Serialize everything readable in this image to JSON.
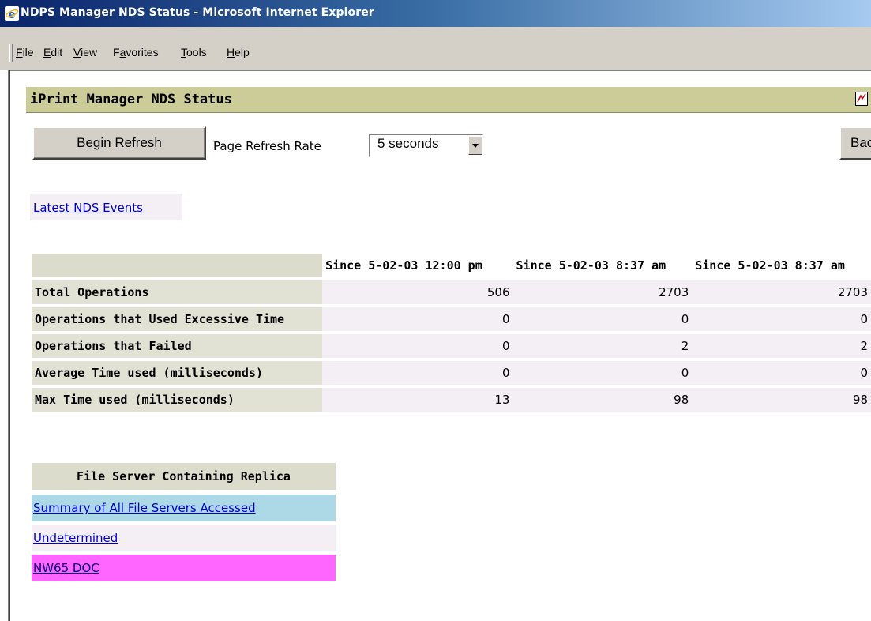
{
  "window": {
    "title": "NDPS Manager NDS Status - Microsoft Internet Explorer",
    "icon": "ie-icon"
  },
  "menu": {
    "items": [
      {
        "label": "File",
        "ul": "F",
        "rest": "ile"
      },
      {
        "label": "Edit",
        "ul": "E",
        "rest": "dit"
      },
      {
        "label": "View",
        "ul": "V",
        "rest": "iew"
      },
      {
        "label": "Favorites",
        "pre": "F",
        "ul": "a",
        "rest": "vorites"
      },
      {
        "label": "Tools",
        "ul": "T",
        "rest": "ools"
      },
      {
        "label": "Help",
        "ul": "H",
        "rest": "elp"
      }
    ]
  },
  "header": {
    "title": "iPrint Manager NDS Status",
    "help_icon": "help-icon"
  },
  "controls": {
    "refresh_button": "Begin Refresh",
    "refresh_rate_label": "Page Refresh Rate",
    "refresh_rate_value": "5 seconds",
    "back_button": "Back"
  },
  "links": {
    "latest_events": "Latest NDS Events"
  },
  "stats": {
    "columns": [
      "Since 5-02-03 12:00 pm",
      "Since 5-02-03 8:37 am",
      "Since 5-02-03 8:37 am"
    ],
    "rows": [
      {
        "label": "Total Operations",
        "values": [
          "506",
          "2703",
          "2703"
        ]
      },
      {
        "label": "Operations that Used Excessive Time",
        "values": [
          "0",
          "0",
          "0"
        ]
      },
      {
        "label": "Operations that Failed",
        "values": [
          "0",
          "2",
          "2"
        ]
      },
      {
        "label": "Average Time used (milliseconds)",
        "values": [
          "0",
          "0",
          "0"
        ]
      },
      {
        "label": "Max Time used (milliseconds)",
        "values": [
          "13",
          "98",
          "98"
        ]
      }
    ]
  },
  "file_servers": {
    "header": "File Server Containing Replica",
    "rows": [
      {
        "label": "Summary of All File Servers Accessed",
        "color": "#add8e6"
      },
      {
        "label": "Undetermined",
        "color": "#f4eff4"
      },
      {
        "label": "NW65 DOC",
        "color": "#ff66ff"
      }
    ]
  },
  "colors": {
    "titlebar_start": "#0a246a",
    "header_bar": "#cccc99",
    "link": "#0000cc"
  }
}
